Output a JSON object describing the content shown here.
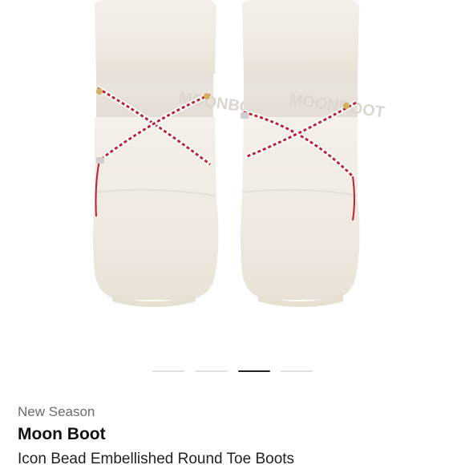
{
  "gallery": {
    "image_icon": "moon-boot-product-image",
    "dot_count": 4,
    "active_index": 2,
    "colors": {
      "fur": "#f1ece4",
      "lace_red": "#b8243a",
      "lace_white": "#ffffff",
      "active_dot": "#222222",
      "inactive_dot": "#e2e2e2"
    }
  },
  "product": {
    "season": "New Season",
    "brand": "Moon Boot",
    "name": "Icon Bead Embellished Round Toe Boots"
  }
}
